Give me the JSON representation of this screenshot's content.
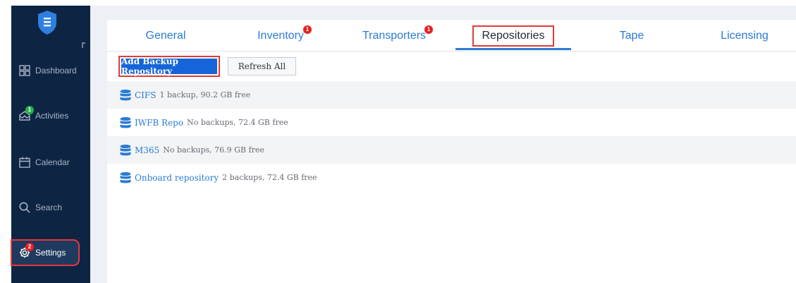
{
  "sidebar": {
    "items": [
      {
        "label": "Dashboard",
        "icon": "dashboard-icon"
      },
      {
        "label": "Activities",
        "icon": "activities-icon",
        "badge": "1"
      },
      {
        "label": "Calendar",
        "icon": "calendar-icon"
      },
      {
        "label": "Search",
        "icon": "search-icon"
      },
      {
        "label": "Settings",
        "icon": "settings-icon",
        "badge": "2"
      }
    ],
    "active": "Settings"
  },
  "tabs": [
    {
      "label": "General"
    },
    {
      "label": "Inventory",
      "badge": "1"
    },
    {
      "label": "Transporters",
      "badge": "1"
    },
    {
      "label": "Repositories",
      "selected": true
    },
    {
      "label": "Tape"
    },
    {
      "label": "Licensing"
    }
  ],
  "toolbar": {
    "add_label": "Add Backup Repository",
    "refresh_label": "Refresh All"
  },
  "repositories": [
    {
      "name": "CIFS",
      "info": "1 backup, 90.2 GB free"
    },
    {
      "name": "IWFB Repo",
      "info": "No backups, 72.4 GB free"
    },
    {
      "name": "M365",
      "info": "No backups, 76.9 GB free"
    },
    {
      "name": "Onboard repository",
      "info": "2 backups, 72.4 GB free"
    }
  ],
  "colors": {
    "sidebar": "#0e2443",
    "accent": "#2a7bd3",
    "primary_button": "#1565d8",
    "highlight": "#e23a3a",
    "badge_red": "#e82020",
    "badge_green": "#27b04c"
  }
}
